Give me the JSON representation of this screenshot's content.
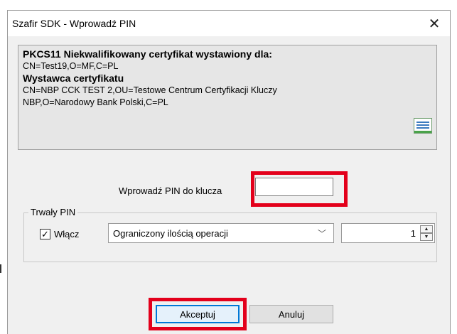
{
  "window": {
    "title": "Szafir SDK - Wprowadź PIN",
    "close_glyph": "✕"
  },
  "certificate": {
    "heading": "PKCS11 Niekwalifikowany certyfikat wystawiony dla:",
    "subject": "CN=Test19,O=MF,C=PL",
    "issuer_heading": "Wystawca certyfikatu",
    "issuer_line1": "CN=NBP CCK TEST 2,OU=Testowe Centrum Certyfikacji Kluczy",
    "issuer_line2": "NBP,O=Narodowy Bank Polski,C=PL",
    "icon": "certificate-icon"
  },
  "pin": {
    "label": "Wprowadź PIN do klucza",
    "value": ""
  },
  "persistent_pin": {
    "legend": "Trwały PIN",
    "enable_label": "Włącz",
    "enabled": true,
    "check_glyph": "✓",
    "mode_value": "Ograniczony ilością operacji",
    "mode_chevron": "﹀",
    "count_value": "1",
    "up_glyph": "▲",
    "down_glyph": "▼"
  },
  "buttons": {
    "accept": "Akceptuj",
    "cancel": "Anuluj"
  },
  "colors": {
    "highlight": "#e3001b",
    "focus": "#0078d7"
  }
}
